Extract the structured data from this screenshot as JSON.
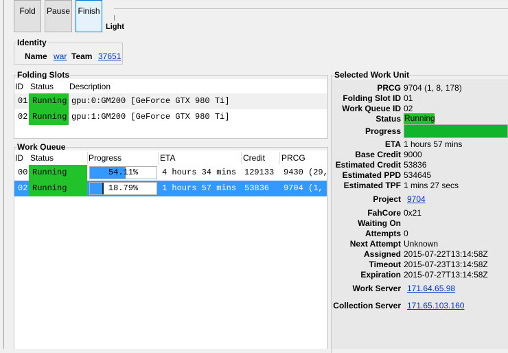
{
  "toolbar": {
    "fold_label": "Fold",
    "pause_label": "Pause",
    "finish_label": "Finish",
    "power_level": "Light"
  },
  "identity": {
    "title": "Identity",
    "name_label": "Name",
    "name_value": "war",
    "team_label": "Team",
    "team_value": "37651"
  },
  "folding_slots": {
    "title": "Folding Slots",
    "headers": {
      "id": "ID",
      "status": "Status",
      "description": "Description"
    },
    "rows": [
      {
        "id": "01",
        "status": "Running",
        "description": "gpu:0:GM200 [GeForce GTX 980 Ti]"
      },
      {
        "id": "02",
        "status": "Running",
        "description": "gpu:1:GM200 [GeForce GTX 980 Ti]"
      }
    ]
  },
  "work_queue": {
    "title": "Work Queue",
    "headers": {
      "id": "ID",
      "status": "Status",
      "progress": "Progress",
      "eta": "ETA",
      "credit": "Credit",
      "prcg": "PRCG"
    },
    "rows": [
      {
        "id": "00",
        "status": "Running",
        "progress_text": "54.11%",
        "progress_value": 0.5411,
        "eta": "4 hours 34 mins",
        "credit": "129133",
        "prcg": "9430 (29,",
        "selected": false
      },
      {
        "id": "02",
        "status": "Running",
        "progress_text": "18.79%",
        "progress_value": 0.1879,
        "eta": "1 hours 57 mins",
        "credit": "53836",
        "prcg": "9704 (1,",
        "selected": true
      }
    ]
  },
  "selected_work_unit": {
    "title": "Selected Work Unit",
    "prcg_label": "PRCG",
    "prcg_value": "9704 (1, 8, 178)",
    "slot_label": "Folding Slot ID",
    "slot_value": "01",
    "queue_label": "Work Queue ID",
    "queue_value": "02",
    "status_label": "Status",
    "status_value": "Running",
    "progress_label": "Progress",
    "progress_value": 1.0,
    "eta_label": "ETA",
    "eta_value": "1 hours 57 mins",
    "base_credit_label": "Base Credit",
    "base_credit_value": "9000",
    "est_credit_label": "Estimated Credit",
    "est_credit_value": "53836",
    "est_ppd_label": "Estimated PPD",
    "est_ppd_value": "534645",
    "est_tpf_label": "Estimated TPF",
    "est_tpf_value": "1 mins 27 secs",
    "project_label": "Project",
    "project_value": "9704",
    "fahcore_label": "FahCore",
    "fahcore_value": "0x21",
    "waiting_label": "Waiting On",
    "waiting_value": "",
    "attempts_label": "Attempts",
    "attempts_value": "0",
    "next_attempt_label": "Next Attempt",
    "next_attempt_value": "Unknown",
    "assigned_label": "Assigned",
    "assigned_value": "2015-07-22T13:14:58Z",
    "timeout_label": "Timeout",
    "timeout_value": "2015-07-23T13:14:58Z",
    "expiration_label": "Expiration",
    "expiration_value": "2015-07-27T13:14:58Z",
    "work_server_label": "Work Server",
    "work_server_value": "171.64.65.98",
    "collection_server_label": "Collection Server",
    "collection_server_value": "171.65.103.160"
  },
  "colors": {
    "status_running": "#22c22a",
    "selection": "#3399ff",
    "link": "#0033cc"
  }
}
